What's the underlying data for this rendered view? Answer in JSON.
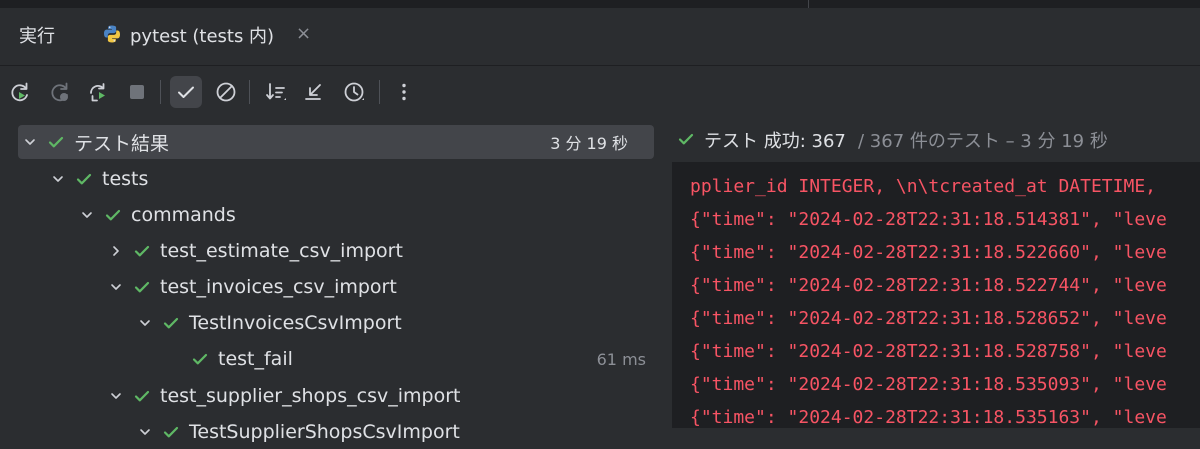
{
  "run_panel": {
    "title": "実行",
    "tab": {
      "label": "pytest (tests 内)",
      "close_glyph": "×"
    }
  },
  "toolbar": {
    "buttons": [
      {
        "name": "rerun-icon",
        "active": false,
        "enabled": true
      },
      {
        "name": "rerun-failed-icon",
        "active": false,
        "enabled": false
      },
      {
        "name": "toggle-auto-test-icon",
        "active": false,
        "enabled": true
      },
      {
        "name": "stop-icon",
        "active": false,
        "enabled": false
      },
      {
        "name": "show-passed-icon",
        "active": true,
        "enabled": true
      },
      {
        "name": "show-ignored-icon",
        "active": false,
        "enabled": true
      },
      {
        "name": "sort-icon",
        "active": false,
        "enabled": true
      },
      {
        "name": "collapse-icon",
        "active": false,
        "enabled": true
      },
      {
        "name": "history-icon",
        "active": false,
        "enabled": true
      },
      {
        "name": "more-icon",
        "active": false,
        "enabled": true
      }
    ]
  },
  "tree": {
    "items": [
      {
        "label": "テスト結果",
        "level": 0,
        "expanded": true,
        "duration": "3 分 19 秒",
        "selected": true
      },
      {
        "label": "tests",
        "level": 1,
        "expanded": true
      },
      {
        "label": "commands",
        "level": 2,
        "expanded": true
      },
      {
        "label": "test_estimate_csv_import",
        "level": 3,
        "expanded": false
      },
      {
        "label": "test_invoices_csv_import",
        "level": 3,
        "expanded": true
      },
      {
        "label": "TestInvoicesCsvImport",
        "level": 4,
        "expanded": true
      },
      {
        "label": "test_fail",
        "level": 5,
        "leaf": true,
        "duration": "61 ms"
      },
      {
        "label": "test_supplier_shops_csv_import",
        "level": 3,
        "expanded": true
      },
      {
        "label": "TestSupplierShopsCsvImport",
        "level": 4,
        "expanded": true
      }
    ]
  },
  "status": {
    "passed_text": "テスト 成功: 367",
    "total_text": "/ 367 件のテスト – 3 分 19 秒"
  },
  "console": {
    "lines": [
      "pplier_id INTEGER, \\n\\tcreated_at DATETIME, ",
      "{\"time\": \"2024-02-28T22:31:18.514381\", \"leve",
      "{\"time\": \"2024-02-28T22:31:18.522660\", \"leve",
      "{\"time\": \"2024-02-28T22:31:18.522744\", \"leve",
      "{\"time\": \"2024-02-28T22:31:18.528652\", \"leve",
      "{\"time\": \"2024-02-28T22:31:18.528758\", \"leve",
      "{\"time\": \"2024-02-28T22:31:18.535093\", \"leve",
      "{\"time\": \"2024-02-28T22:31:18.535163\", \"leve"
    ]
  },
  "colors": {
    "accent_green": "#5fb865",
    "error_red": "#f75464",
    "panel_bg": "#2b2d30",
    "console_bg": "#1e1f22"
  }
}
